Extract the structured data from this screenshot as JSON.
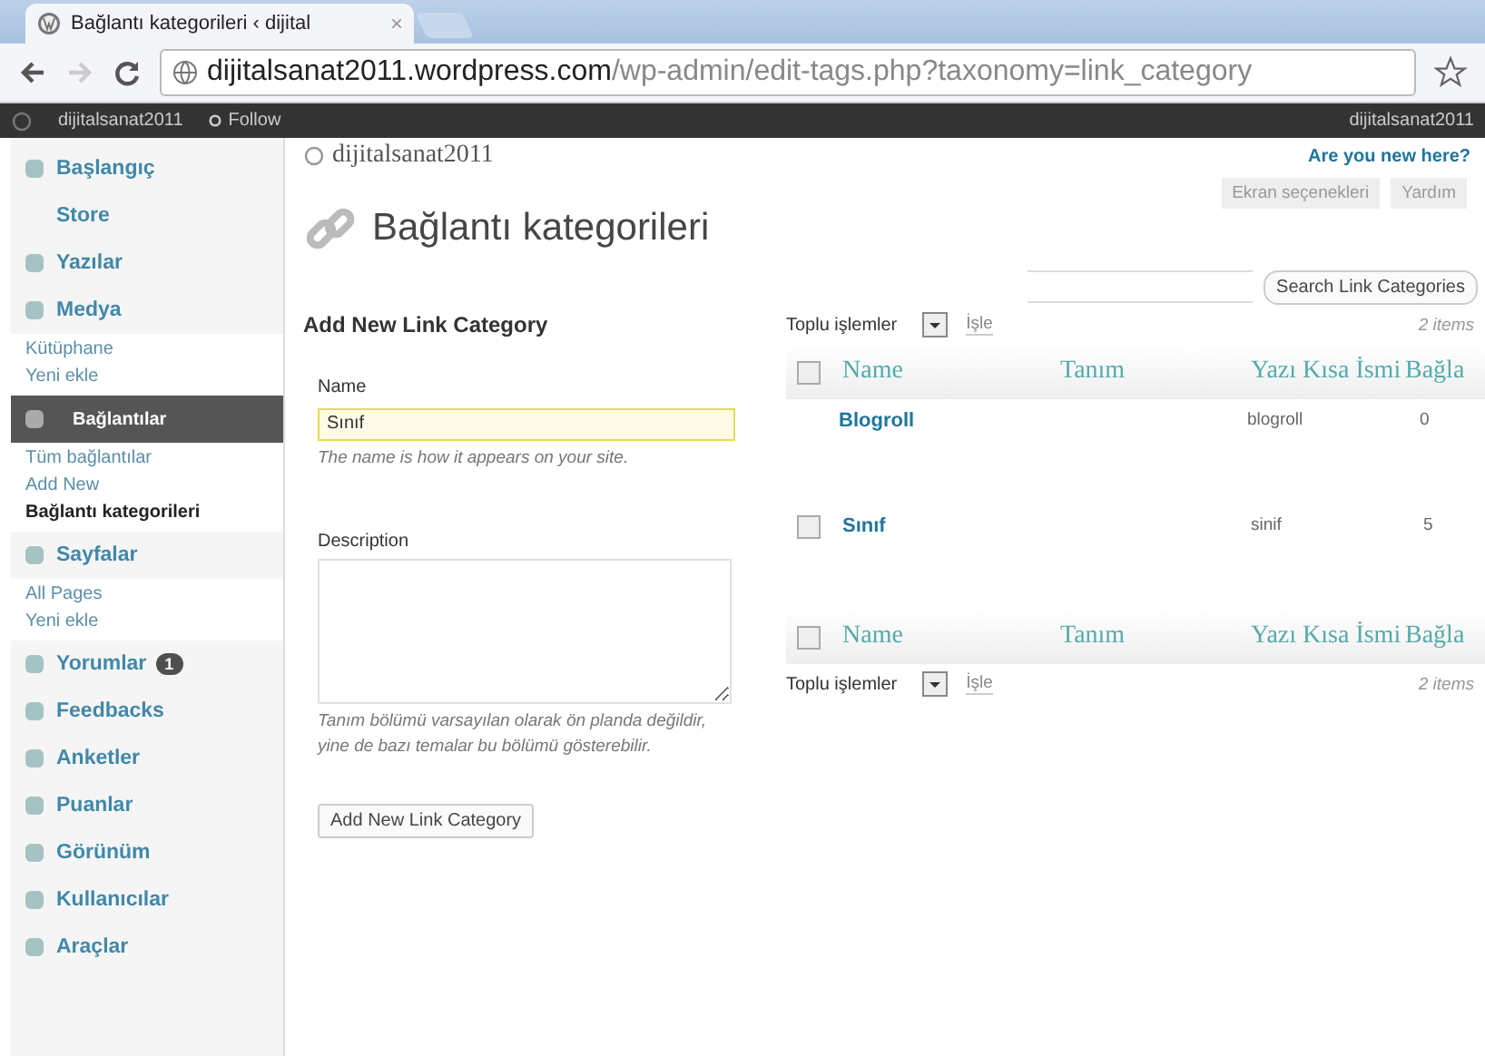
{
  "browser": {
    "tab_title": "Bağlantı kategorileri ‹ dijital",
    "tab_close": "×",
    "url_host": "dijitalsanat2011.wordpress.com",
    "url_path": "/wp-admin/edit-tags.php?taxonomy=link_category"
  },
  "admin_bar": {
    "site": "dijitalsanat2011",
    "follow": "Follow",
    "user": "dijitalsanat2011"
  },
  "sidebar": {
    "items": [
      {
        "label": "Başlangıç",
        "selected": false
      },
      {
        "label": "Store",
        "selected": false
      },
      {
        "label": "Yazılar",
        "selected": false
      },
      {
        "label": "Medya",
        "selected": false,
        "children": [
          {
            "label": "Kütüphane",
            "selected": false
          },
          {
            "label": "Yeni ekle",
            "selected": false
          }
        ]
      },
      {
        "label": "Bağlantılar",
        "selected": true,
        "children": [
          {
            "label": "Tüm bağlantılar",
            "selected": false
          },
          {
            "label": "Add New",
            "selected": false
          },
          {
            "label": "Bağlantı kategorileri",
            "selected": true
          }
        ]
      },
      {
        "label": "Sayfalar",
        "selected": false,
        "children": [
          {
            "label": "All Pages",
            "selected": false
          },
          {
            "label": "Yeni ekle",
            "selected": false
          }
        ]
      },
      {
        "label": "Yorumlar",
        "selected": false,
        "badge": "1"
      },
      {
        "label": "Feedbacks",
        "selected": false
      },
      {
        "label": "Anketler",
        "selected": false
      },
      {
        "label": "Puanlar",
        "selected": false
      },
      {
        "label": "Görünüm",
        "selected": false
      },
      {
        "label": "Kullanıcılar",
        "selected": false
      },
      {
        "label": "Araçlar",
        "selected": false
      }
    ]
  },
  "header": {
    "site_title": "dijitalsanat2011",
    "new_here": "Are you new here?",
    "screen_options": "Ekran seçenekleri",
    "help": "Yardım",
    "page_title": "Bağlantı kategorileri",
    "search_button": "Search Link Categories"
  },
  "form": {
    "title": "Add New Link Category",
    "name_label": "Name",
    "name_value": "Sınıf",
    "name_hint": "The name is how it appears on your site.",
    "description_label": "Description",
    "description_hint": "Tanım bölümü varsayılan olarak ön planda değildir, yine de bazı temalar bu bölümü gösterebilir.",
    "submit": "Add New Link Category"
  },
  "table": {
    "top_bar": {
      "bulk_action": "Toplu işlemler",
      "apply": "İşle",
      "count": "2 items"
    },
    "header": {
      "checked": false,
      "columns": [
        "Name",
        "Tanım",
        "Yazı Kısa İsmi",
        "Bağla"
      ]
    },
    "rows": [
      {
        "selectable": false,
        "name": "Blogroll",
        "slug": "blogroll",
        "links": "0"
      },
      {
        "selectable": true,
        "checked": false,
        "name": "Sınıf",
        "slug": "sinif",
        "links": "5"
      }
    ],
    "footer": {
      "checked": false,
      "columns": [
        "Name",
        "Tanım",
        "Yazı Kısa İsmi",
        "Bağla"
      ]
    },
    "bottom_bar": {
      "bulk_action": "Toplu işlemler",
      "apply": "İşle",
      "count": "2 items"
    }
  }
}
